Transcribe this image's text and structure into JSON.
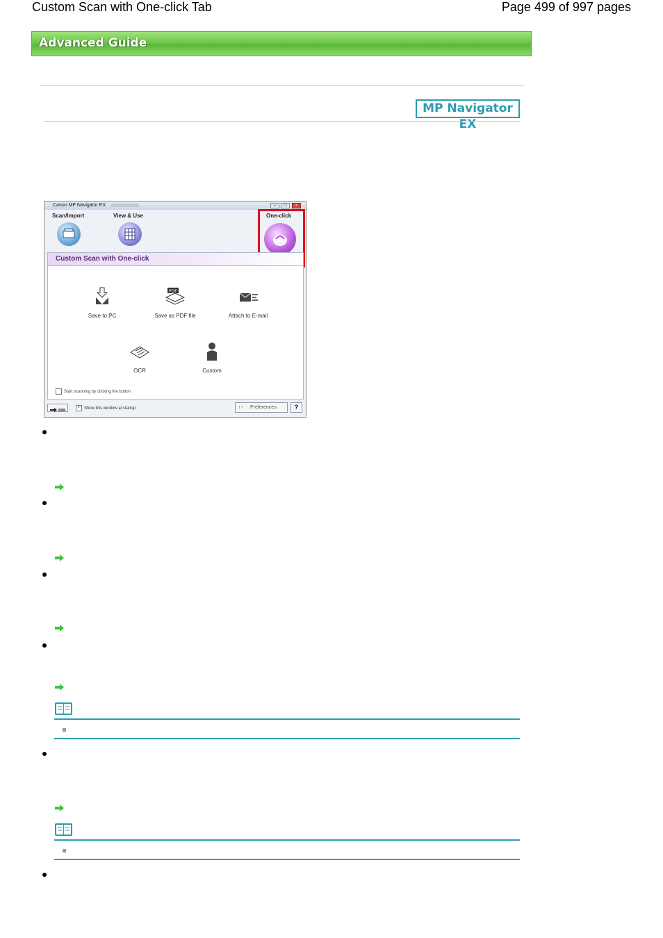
{
  "header": {
    "title": "Custom Scan with One-click Tab",
    "page_info": "Page 499 of 997 pages"
  },
  "banner": {
    "label": "Advanced Guide"
  },
  "product_badge": "MP Navigator EX",
  "screenshot": {
    "window_title": "Canon MP Navigator EX",
    "modes": {
      "scan_import": "Scan/Import",
      "view_use": "View & Use",
      "one_click": "One-click"
    },
    "panel_title": "Custom Scan with One-click",
    "functions": {
      "save_to_pc": "Save to PC",
      "save_as_pdf": "Save as PDF file",
      "attach_email": "Attach to E-mail",
      "ocr": "OCR",
      "custom": "Custom"
    },
    "pdf_tag": "PDF",
    "start_scanning_checkbox": "Start scanning by clicking the button",
    "show_window_checkbox": "Show this window at startup",
    "preferences_button": "Preferences",
    "help_button": "?"
  },
  "colors": {
    "banner_green": "#6cc64a",
    "accent_teal": "#2a9db0",
    "highlight_red": "#e2001a",
    "arrow_green": "#3cc43c"
  }
}
